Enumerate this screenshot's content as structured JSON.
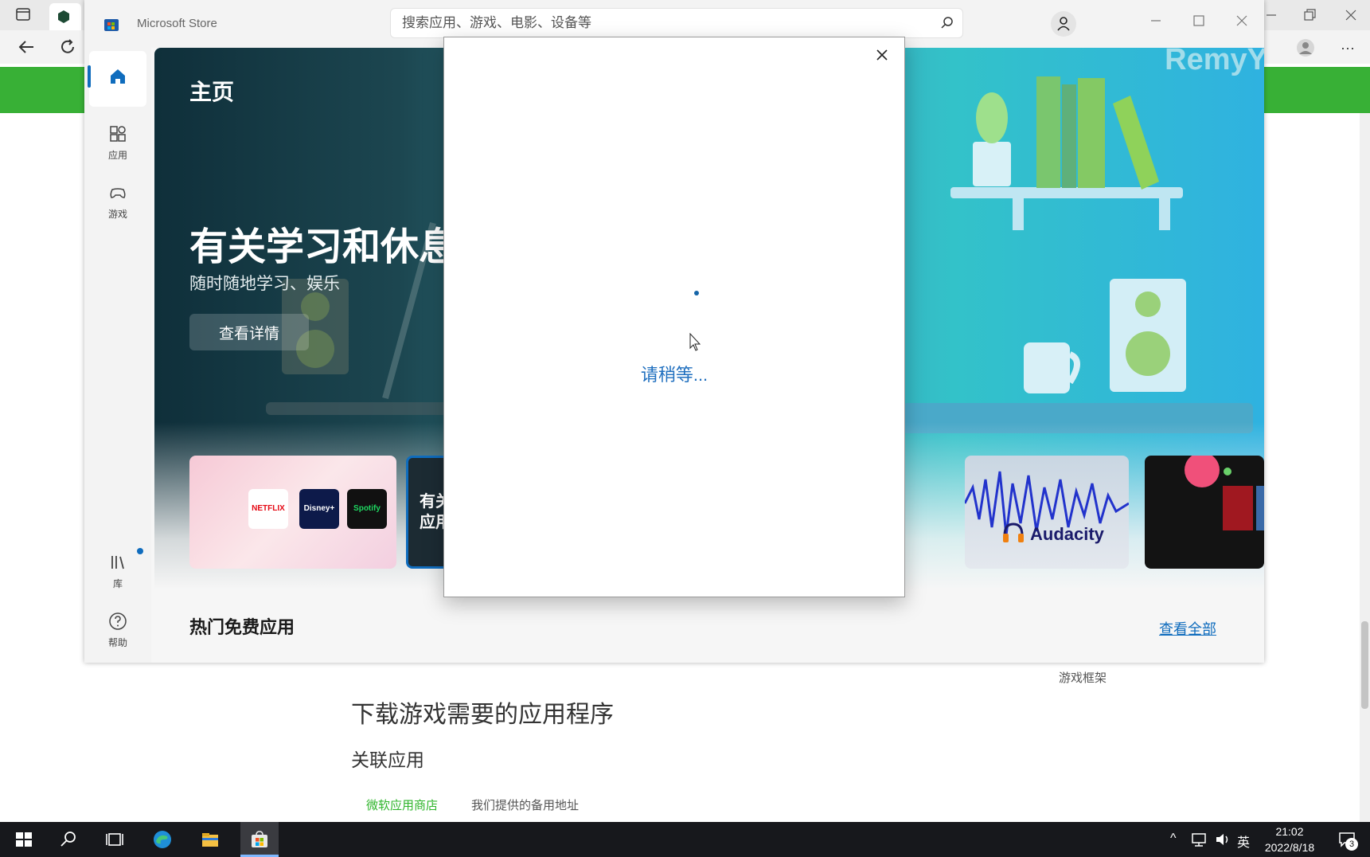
{
  "store": {
    "title": "Microsoft Store",
    "search_placeholder": "搜索应用、游戏、电影、设备等",
    "nav": {
      "apps_label": "应用",
      "games_label": "游戏",
      "library_label": "库",
      "help_label": "帮助"
    },
    "hero": {
      "page_title": "主页",
      "headline": "有关学习和休息",
      "subtitle": "随时随地学习、娱乐",
      "cta_label": "查看详情",
      "watermark": "RemyY"
    },
    "cards": {
      "dark_card_text_line1": "有关",
      "dark_card_text_line2": "应用",
      "audacity_label": "Audacity",
      "netflix_label": "NETFLIX",
      "disney_label": "Disney+",
      "spotify_label": "Spotify"
    },
    "section_title": "热门免费应用",
    "view_all_label": "查看全部"
  },
  "dialog": {
    "wait_text": "请稍等..."
  },
  "background_page": {
    "heading": "下载游戏需要的应用程序",
    "subheading": "关联应用",
    "link_store": "微软应用商店",
    "link_backup": "我们提供的备用地址",
    "side_label": "游戏框架"
  },
  "taskbar": {
    "ime_label": "英",
    "time": "21:02",
    "date": "2022/8/18",
    "notification_count": "3"
  },
  "colors": {
    "accent": "#0f6cbd",
    "green_banner": "#38b036",
    "taskbar": "#17181c"
  }
}
